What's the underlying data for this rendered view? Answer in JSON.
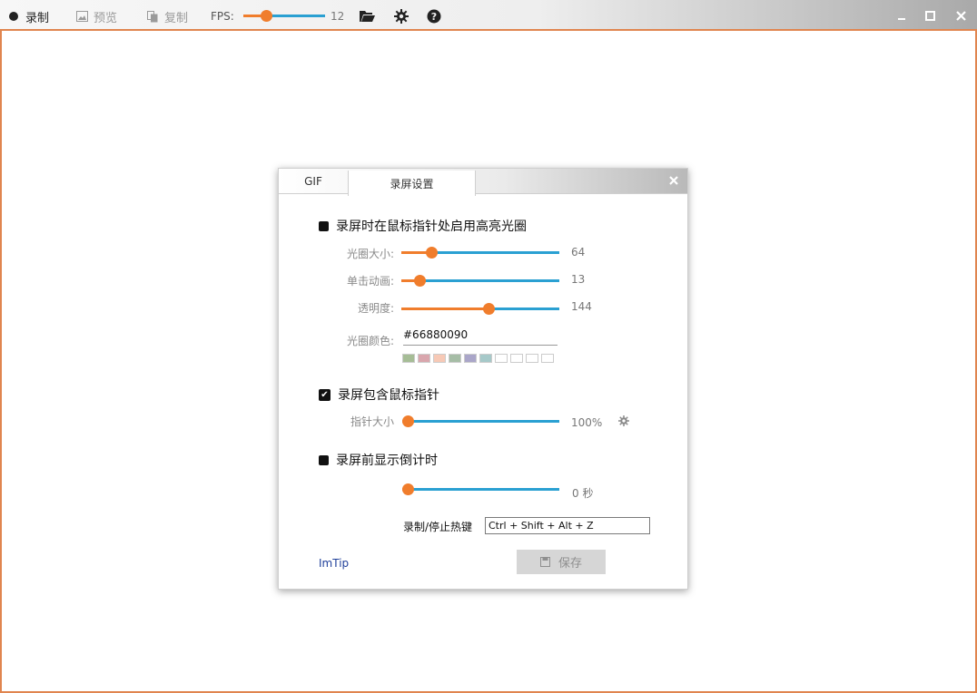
{
  "toolbar": {
    "record_label": "录制",
    "preview_label": "预览",
    "copy_label": "复制",
    "fps_label": "FPS:",
    "fps_value": "12",
    "fps_fraction": 0.25,
    "folder_icon": "folder-open-icon",
    "settings_icon": "gear-icon",
    "help_icon": "help-icon"
  },
  "window_controls": {
    "minimize": "–",
    "maximize": "☐",
    "close": "✕"
  },
  "dialog": {
    "tabs": [
      {
        "label": "GIF"
      },
      {
        "label": "录屏设置",
        "active": true
      }
    ],
    "close": "✕",
    "highlight_section": {
      "label": "录屏时在鼠标指针处启用高亮光圈",
      "checked": false,
      "size_label": "光圈大小:",
      "size_value": "64",
      "size_fraction": 0.17,
      "click_anim_label": "单击动画:",
      "click_anim_value": "13",
      "click_anim_fraction": 0.09,
      "opacity_label": "透明度:",
      "opacity_value": "144",
      "opacity_fraction": 0.56,
      "color_label": "光圈颜色:",
      "color_value": "#66880090",
      "swatches": [
        "#a6bd96",
        "#d9a6ad",
        "#f7c9b6",
        "#a6bda6",
        "#aaa6c9",
        "#a6c9c9",
        "#ffffff",
        "#ffffff",
        "#ffffff",
        "#ffffff"
      ]
    },
    "cursor_section": {
      "label": "录屏包含鼠标指针",
      "checked": true,
      "pointer_size_label": "指针大小",
      "pointer_size_value": "100%",
      "pointer_size_fraction": 0.0
    },
    "countdown_section": {
      "label": "录屏前显示倒计时",
      "checked": false,
      "countdown_value": "0 秒",
      "countdown_fraction": 0.0
    },
    "hotkey_label": "录制/停止热键",
    "hotkey_value": "Ctrl + Shift + Alt + Z",
    "imtip_link": "ImTip",
    "save_label": "保存"
  },
  "colors": {
    "accent_orange": "#f07d2c",
    "track_blue": "#2aa0d2",
    "window_border": "#e0854f"
  }
}
